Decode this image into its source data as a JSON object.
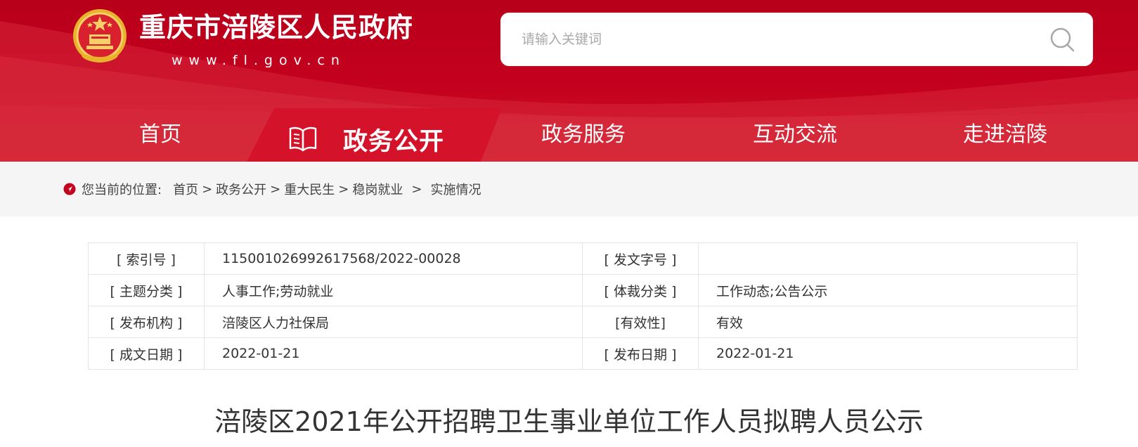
{
  "header": {
    "site_title": "重庆市涪陵区人民政府",
    "site_url": "www.fl.gov.cn",
    "emblem_icon": "national-emblem-icon",
    "colors": {
      "primary": "#c4011e",
      "accent": "#d4132a"
    }
  },
  "search": {
    "placeholder": "请输入关键词",
    "value": "",
    "icon": "search-icon"
  },
  "nav": {
    "items": [
      {
        "label": "首页"
      },
      {
        "label": "政务公开",
        "active": true,
        "icon": "book-icon"
      },
      {
        "label": "政务服务"
      },
      {
        "label": "互动交流"
      },
      {
        "label": "走进涪陵"
      }
    ]
  },
  "breadcrumb": {
    "prefix": "您当前的位置:",
    "icon": "location-pin-icon",
    "items": [
      "首页",
      "政务公开",
      "重大民生",
      "稳岗就业",
      "实施情况"
    ],
    "separator": ">"
  },
  "meta": {
    "rows": [
      {
        "k1": "[ 索引号 ]",
        "v1": "115001026992617568/2022-00028",
        "k2": "[ 发文字号 ]",
        "v2": ""
      },
      {
        "k1": "[ 主题分类 ]",
        "v1": "人事工作;劳动就业",
        "k2": "[ 体裁分类 ]",
        "v2": "工作动态;公告公示"
      },
      {
        "k1": "[ 发布机构 ]",
        "v1": "涪陵区人力社保局",
        "k2": "[有效性]",
        "v2": "有效"
      },
      {
        "k1": "[ 成文日期 ]",
        "v1": "2022-01-21",
        "k2": "[ 发布日期 ]",
        "v2": "2022-01-21"
      }
    ]
  },
  "document": {
    "title": "涪陵区2021年公开招聘卫生事业单位工作人员拟聘人员公示"
  }
}
